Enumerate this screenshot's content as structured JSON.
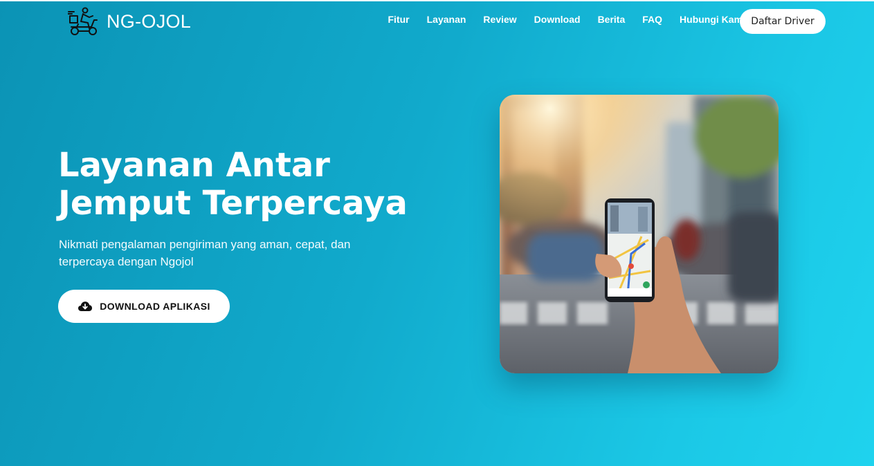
{
  "brand": {
    "name": "NG-OJOL",
    "logo_icon": "scooter-courier-icon"
  },
  "nav": {
    "items": [
      "Fitur",
      "Layanan",
      "Review",
      "Download",
      "Berita",
      "FAQ",
      "Hubungi Kami"
    ],
    "cta": "Daftar Driver"
  },
  "hero": {
    "title": "Layanan Antar Jemput Terpercaya",
    "subtitle": "Nikmati pengalaman pengiriman yang aman, cepat, dan terpercaya dengan Ngojol",
    "button": {
      "label": "DOWNLOAD APLIKASI",
      "icon": "cloud-download-icon"
    },
    "image_icon": "phone-map-street-photo"
  },
  "colors": {
    "gradient_start": "#0b93b5",
    "gradient_end": "#1fd3ee",
    "button_bg": "#ffffff"
  }
}
